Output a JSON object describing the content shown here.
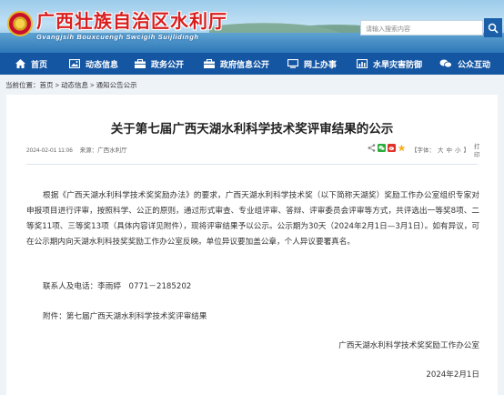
{
  "header": {
    "title": "广西壮族自治区水利厅",
    "title_zhuang": "Gvangjsih Bouxcuengh Swcigih Suijlidingh",
    "search_placeholder": "请输入搜索内容"
  },
  "nav": {
    "items": [
      {
        "label": "首页",
        "icon": "home-icon"
      },
      {
        "label": "动态信息",
        "icon": "image-icon"
      },
      {
        "label": "政务公开",
        "icon": "briefcase-icon"
      },
      {
        "label": "政府信息公开",
        "icon": "briefcase-icon"
      },
      {
        "label": "网上办事",
        "icon": "monitor-icon"
      },
      {
        "label": "水旱灾害防御",
        "icon": "bar-chart-icon"
      },
      {
        "label": "公众互动",
        "icon": "chat-icon"
      }
    ]
  },
  "breadcrumb": {
    "prefix": "当前位置：",
    "items": [
      "首页",
      "动态信息",
      "通知公告公示"
    ],
    "sep": " > "
  },
  "article": {
    "title": "关于第七届广西天湖水利科学技术奖评审结果的公示",
    "date": "2024-02-01 11:06",
    "source": "来源：广西水利厅",
    "font_label": "【字体：",
    "font_large": "大",
    "font_medium": "中",
    "font_small": "小",
    "font_close": "】",
    "print": "打印",
    "body": "根据《广西天湖水利科学技术奖奖励办法》的要求，广西天湖水利科学技术奖（以下简称天湖奖）奖励工作办公室组织专家对申报项目进行评审，按照科学、公正的原则，通过形式审查、专业组评审、答辩、评审委员会评审等方式，共评选出一等奖8项、二等奖11项、三等奖13项（具体内容详见附件），现将评审结果予以公示。公示期为30天（2024年2月1日—3月1日）。如有异议，可在公示期内向天湖水利科技奖奖励工作办公室反映。单位异议要加盖公章，个人异议要署真名。",
    "contact": "联系人及电话：李雨婷　0771－2185202",
    "attachment": "附件：第七届广西天湖水利科学技术奖评审结果",
    "signer": "广西天湖水利科学技术奖奖励工作办公室",
    "sign_date": "2024年2月1日"
  },
  "colors": {
    "nav_bg": "#1556a3",
    "title_red": "#d81e1e",
    "accent_red": "#e0332c",
    "share_green": "#2aae3c"
  }
}
